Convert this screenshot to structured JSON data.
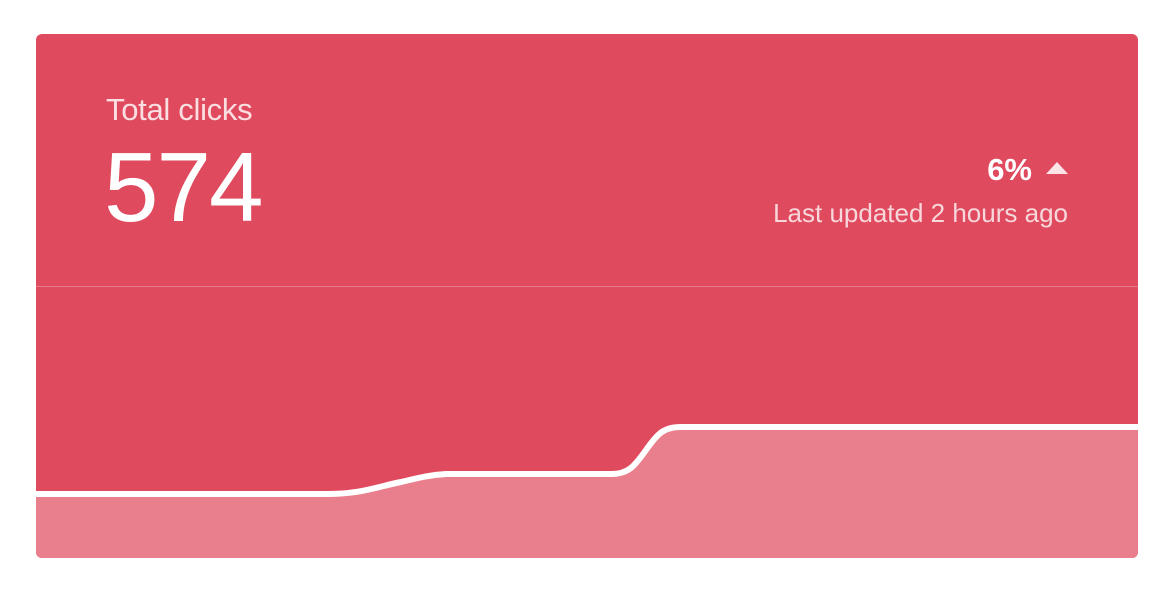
{
  "card": {
    "title": "Total clicks",
    "value": "574",
    "change": "6%",
    "change_direction_icon": "triangle-up-icon",
    "updated": "Last updated 2 hours ago",
    "colors": {
      "background": "#e04a5e",
      "area_fill": "#e97f8c",
      "line": "#ffffff"
    }
  }
}
